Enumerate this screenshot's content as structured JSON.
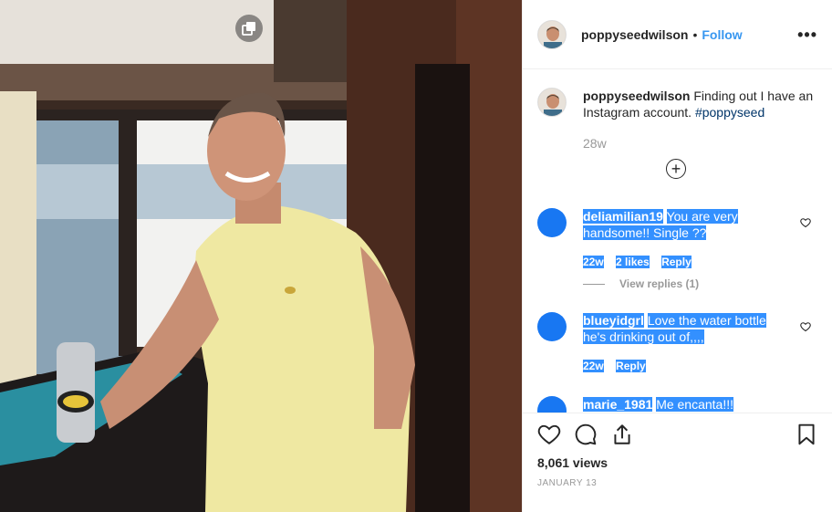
{
  "post": {
    "username": "poppyseedwilson",
    "separator": "•",
    "follow_label": "Follow",
    "more_icon": "•••",
    "caption_text": "Finding out I have an Instagram account.",
    "caption_hashtag": "#poppyseed",
    "caption_time": "28w",
    "load_more_icon": "+"
  },
  "comments": [
    {
      "username": "deliamilian19",
      "text": "You are very handsome!! Single ??",
      "time": "22w",
      "likes": "2 likes",
      "reply_label": "Reply",
      "view_replies": "View replies (1)"
    },
    {
      "username": "blueyidgrl",
      "text": "Love the water bottle he's drinking out of,,,,",
      "time": "22w",
      "reply_label": "Reply"
    },
    {
      "username": "marie_1981",
      "text": "Me encanta!!!"
    }
  ],
  "footer": {
    "views": "8,061 views",
    "date": "JANUARY 13"
  },
  "icons": {
    "multi_post": "multi-post-icon",
    "like": "heart-icon",
    "comment": "comment-icon",
    "share": "share-icon",
    "save": "bookmark-icon"
  },
  "colors": {
    "follow": "#3897f0",
    "highlight": "#3390ff",
    "avatar_default": "#1877f2"
  }
}
